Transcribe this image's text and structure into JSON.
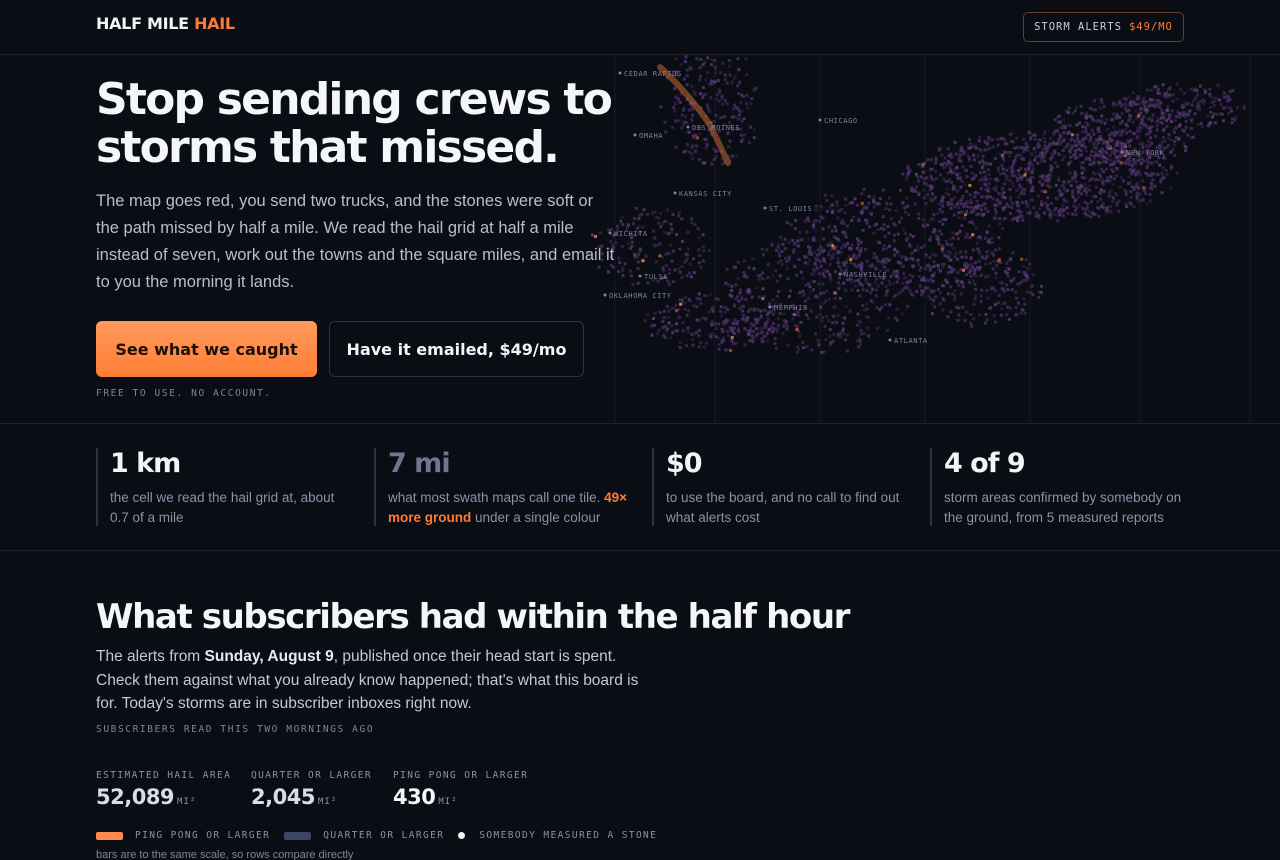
{
  "header": {
    "logo_main": "HALF MILE",
    "logo_accent": "HAIL",
    "alerts_label": "STORM ALERTS",
    "alerts_price": "$49/MO"
  },
  "hero": {
    "title": "Stop sending crews to storms that missed.",
    "body": "The map goes red, you send two trucks, and the stones were soft or the path missed by half a mile. We read the hail grid at half a mile instead of seven, work out the towns and the square miles, and email it to you the morning it lands.",
    "primary_button": "See what we caught",
    "secondary_button": "Have it emailed, $49/mo",
    "free_note": "FREE TO USE. NO ACCOUNT."
  },
  "map": {
    "cities": [
      "CEDAR RAPIDS",
      "OMAHA",
      "DES MOINES",
      "CHICAGO",
      "KANSAS CITY",
      "ST. LOUIS",
      "WICHITA",
      "TULSA",
      "OKLAHOMA CITY",
      "NASHVILLE",
      "MEMPHIS",
      "ATLANTA",
      "NEW YORK"
    ]
  },
  "stats": [
    {
      "value": "1 km",
      "desc": "the cell we read the hail grid at, about 0.7 of a mile",
      "highlight": "",
      "tail": ""
    },
    {
      "value": "7 mi",
      "desc": "what most swath maps call one tile. ",
      "highlight": "49× more ground",
      "tail": " under a single colour"
    },
    {
      "value": "$0",
      "desc": "to use the board, and no call to find out what alerts cost",
      "highlight": "",
      "tail": ""
    },
    {
      "value": "4 of 9",
      "desc": "storm areas confirmed by somebody on the ground, from 5 measured reports",
      "highlight": "",
      "tail": ""
    }
  ],
  "section": {
    "title": "What subscribers had within the half hour",
    "copy_pre": "The alerts from ",
    "copy_date": "Sunday, August 9",
    "copy_post": ", published once their head start is spent. Check them against what you already know happened; that's what this board is for. Today's storms are in subscriber inboxes right now.",
    "note": "SUBSCRIBERS READ THIS TWO MORNINGS AGO",
    "metrics": [
      {
        "label": "ESTIMATED HAIL AREA",
        "value": "52,089",
        "unit": "MI²"
      },
      {
        "label": "QUARTER OR LARGER",
        "value": "2,045",
        "unit": "MI²"
      },
      {
        "label": "PING PONG OR LARGER",
        "value": "430",
        "unit": "MI²"
      }
    ],
    "legend": [
      {
        "label": "PING PONG OR LARGER",
        "color": "#ff8a4c"
      },
      {
        "label": "QUARTER OR LARGER",
        "color": "#3c4566"
      },
      {
        "label": "SOMEBODY MEASURED A STONE",
        "color": "#f2f4fa"
      }
    ],
    "scale_note": "bars are to the same scale, so rows compare directly"
  },
  "colors": {
    "background": "#0b0d15",
    "accent": "#ff7a33",
    "hail_purple": "#4a2f63",
    "hail_orange": "#ff8a3a"
  }
}
